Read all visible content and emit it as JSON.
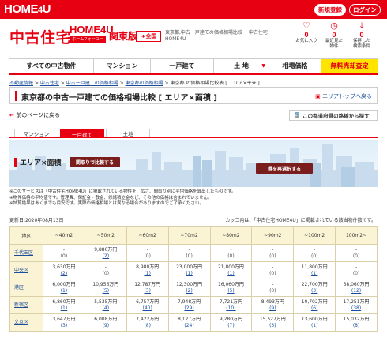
{
  "topbar": {
    "brand": "HOME",
    "brand_num": "4",
    "brand_end": "U",
    "register": "新規登録",
    "login": "ログイン"
  },
  "header": {
    "logo": "中古住宅",
    "logo_home": "HOME4U",
    "logo_sub": "ホームフォーユー",
    "region": "関東版",
    "zenkoku": "全国",
    "desc_line1": "東京都,中古一戸建ての価格相場比較 －中古住宅",
    "desc_line2": "HOME4U"
  },
  "header_icons": [
    {
      "icon": "heart-icon",
      "glyph": "♡",
      "count": "0",
      "label1": "お気に入り",
      "label2": ""
    },
    {
      "icon": "clock-icon",
      "glyph": "◷",
      "count": "0",
      "label1": "最近見た",
      "label2": "物件"
    },
    {
      "icon": "download-icon",
      "glyph": "⤓",
      "count": "0",
      "label1": "保存した",
      "label2": "検索条件"
    }
  ],
  "nav": [
    {
      "label": "すべての中古物件",
      "highlight": false
    },
    {
      "label": "マンション",
      "highlight": false
    },
    {
      "label": "一戸建て",
      "highlight": false
    },
    {
      "label": "土 地",
      "highlight": false
    },
    {
      "label": "相場価格",
      "highlight": false
    },
    {
      "label": "無料売却査定",
      "highlight": true
    }
  ],
  "breadcrumb": [
    "不動産情報",
    "中古住宅",
    "中古一戸建ての価格相場",
    "東京都の価格相場",
    "東京都 の価格相場比較表 [ エリア×平米 ]"
  ],
  "page_title": "東京都の中古一戸建ての価格相場比較 [ エリア×面積 ]",
  "area_top_link": "エリアトップへ戻る",
  "back_link": "前のページに戻る",
  "route_button": "この都道府県の路線から探す",
  "tabs": [
    {
      "label": "マンション",
      "active": false
    },
    {
      "label": "一戸建て",
      "active": true
    },
    {
      "label": "土地",
      "active": false
    }
  ],
  "banner": {
    "title": "エリア×面積",
    "compare_button": "間取りで比較する",
    "reselect_button": "県を再選択する"
  },
  "notes": [
    "※このサービスは「中古住宅HOME4U」に掲載されている物件を、広さ、間取り別に平均価格を算出したものです。",
    "※物件価格の平均値です。管理費、保証金・敷金、修繕積立金など、その他の価格は含まれていません。",
    "※試算結果はあくまでも目安です。実際の価格相場とは異なる場合がありますのでご了承ください。"
  ],
  "updated": "更新日:2020年08月13日",
  "source": "カッコ内は、「中古住宅HOME4U」に掲載されている該当物件数です。",
  "table": {
    "headers": [
      "地区",
      "~40m2",
      "~50m2",
      "~60m2",
      "~70m2",
      "~80m2",
      "~90m2",
      "~100m2",
      "100m2~"
    ],
    "rows": [
      {
        "area": "千代田区",
        "cells": [
          [
            "-",
            "(0)"
          ],
          [
            "9,880万円",
            "(2)"
          ],
          [
            "-",
            "(0)"
          ],
          [
            "-",
            "(0)"
          ],
          [
            "-",
            "(0)"
          ],
          [
            "-",
            "(0)"
          ],
          [
            "-",
            "(0)"
          ],
          [
            "-",
            "(0)"
          ]
        ]
      },
      {
        "area": "中央区",
        "cells": [
          [
            "3,630万円",
            "(2)"
          ],
          [
            "-",
            "(0)"
          ],
          [
            "8,980万円",
            "(1)"
          ],
          [
            "23,000万円",
            "(1)"
          ],
          [
            "21,800万円",
            "(1)"
          ],
          [
            "-",
            "(0)"
          ],
          [
            "11,800万円",
            "(1)"
          ],
          [
            "-",
            "(0)"
          ]
        ]
      },
      {
        "area": "港区",
        "cells": [
          [
            "6,000万円",
            "(1)"
          ],
          [
            "10,956万円",
            "(5)"
          ],
          [
            "12,787万円",
            "(3)"
          ],
          [
            "12,300万円",
            "(2)"
          ],
          [
            "16,060万円",
            "(5)"
          ],
          [
            "-",
            "(0)"
          ],
          [
            "22,700万円",
            "(3)"
          ],
          [
            "38,060万円",
            "(12)"
          ]
        ]
      },
      {
        "area": "新宿区",
        "cells": [
          [
            "6,860万円",
            "(1)"
          ],
          [
            "5,535万円",
            "(4)"
          ],
          [
            "6,757万円",
            "(40)"
          ],
          [
            "7,948万円",
            "(29)"
          ],
          [
            "7,721万円",
            "(10)"
          ],
          [
            "8,493万円",
            "(9)"
          ],
          [
            "10,702万円",
            "(6)"
          ],
          [
            "17,251万円",
            "(38)"
          ]
        ]
      },
      {
        "area": "文京区",
        "cells": [
          [
            "3,647万円",
            "(3)"
          ],
          [
            "6,008万円",
            "(9)"
          ],
          [
            "7,422万円",
            "(8)"
          ],
          [
            "8,127万円",
            "(24)"
          ],
          [
            "9,280万円",
            "(7)"
          ],
          [
            "15,527万円",
            "(3)"
          ],
          [
            "13,600万円",
            "(1)"
          ],
          [
            "15,032万円",
            "(8)"
          ]
        ]
      }
    ]
  },
  "colors": {
    "brand_red": "#e60012",
    "highlight_yellow": "#ffe400",
    "table_header_bg": "#faf3d4",
    "link_blue": "#1a4e9c"
  }
}
